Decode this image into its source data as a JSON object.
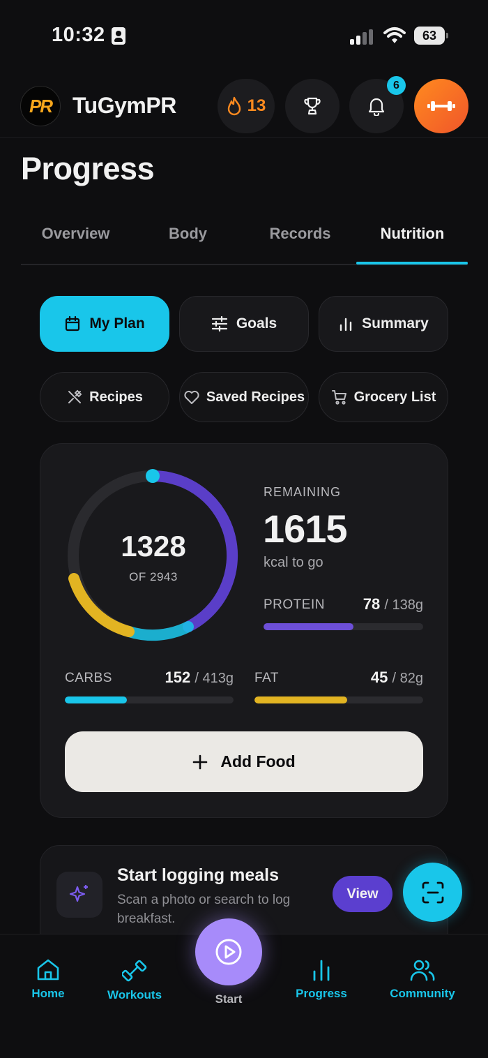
{
  "status_bar": {
    "time": "10:32",
    "battery": "63"
  },
  "header": {
    "brand": "TuGymPR",
    "logo_text": "PR",
    "streak_count": "13",
    "notification_count": "6"
  },
  "page_title": "Progress",
  "tabs": [
    {
      "label": "Overview",
      "active": false
    },
    {
      "label": "Body",
      "active": false
    },
    {
      "label": "Records",
      "active": false
    },
    {
      "label": "Nutrition",
      "active": true
    }
  ],
  "subnav_primary": [
    {
      "label": "My Plan",
      "icon": "calendar-icon",
      "active": true
    },
    {
      "label": "Goals",
      "icon": "sliders-icon",
      "active": false
    },
    {
      "label": "Summary",
      "icon": "bar-chart-icon",
      "active": false
    }
  ],
  "subnav_secondary": [
    {
      "label": "Recipes",
      "icon": "utensils-crossed-icon"
    },
    {
      "label": "Saved Recipes",
      "icon": "heart-icon"
    },
    {
      "label": "Grocery List",
      "icon": "cart-icon"
    }
  ],
  "calories": {
    "consumed": "1328",
    "of_label": "OF 2943",
    "remaining_label": "REMAINING",
    "remaining": "1615",
    "remaining_unit": "kcal to go"
  },
  "macros": {
    "protein": {
      "label": "PROTEIN",
      "value": "78",
      "target": "/ 138g",
      "fill": 0.565,
      "color": "#6d4fd8"
    },
    "carbs": {
      "label": "CARBS",
      "value": "152",
      "target": "/ 413g",
      "fill": 0.368,
      "color": "#19c6ea"
    },
    "fat": {
      "label": "FAT",
      "value": "45",
      "target": "/ 82g",
      "fill": 0.549,
      "color": "#e2b422"
    }
  },
  "add_food_label": "Add Food",
  "logging": {
    "title": "Start logging meals",
    "subtitle": "Scan a photo or search to log breakfast.",
    "view_label": "View"
  },
  "bottom_nav": [
    {
      "label": "Home",
      "icon": "home-icon"
    },
    {
      "label": "Workouts",
      "icon": "dumbbell-icon"
    },
    {
      "label": "Start",
      "icon": "play-circle-icon"
    },
    {
      "label": "Progress",
      "icon": "bar-chart-icon"
    },
    {
      "label": "Community",
      "icon": "users-icon"
    }
  ]
}
